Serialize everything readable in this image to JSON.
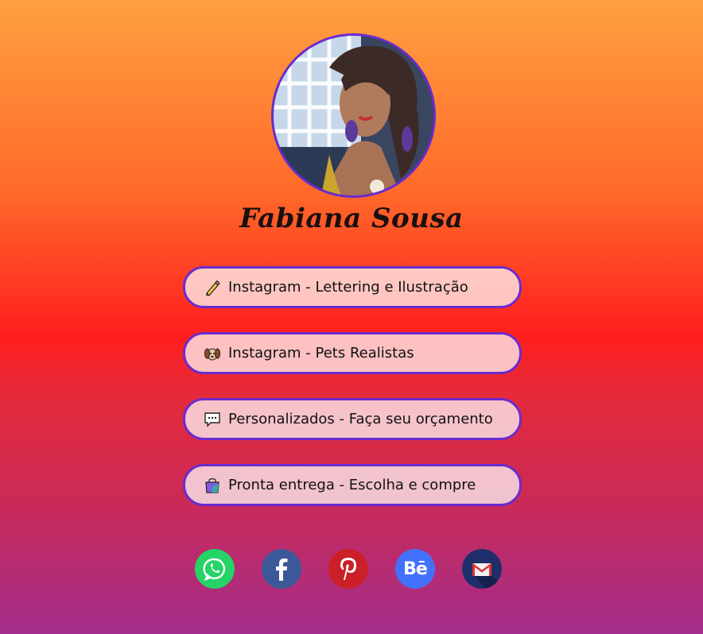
{
  "profile": {
    "name": "Fabiana Sousa",
    "avatar_icon": "profile-photo"
  },
  "links": [
    {
      "label": "Instagram - Lettering e Ilustração",
      "icon": "pencil-icon"
    },
    {
      "label": "Instagram - Pets Realistas",
      "icon": "dog-icon"
    },
    {
      "label": "Personalizados - Faça seu orçamento",
      "icon": "speech-bubble-icon"
    },
    {
      "label": "Pronta entrega - Escolha e compre",
      "icon": "shopping-bag-icon"
    }
  ],
  "social": [
    {
      "name": "whatsapp",
      "color": "#25d366"
    },
    {
      "name": "facebook",
      "color": "#3b5998"
    },
    {
      "name": "pinterest",
      "color": "#cb2027"
    },
    {
      "name": "behance",
      "color": "#4272fb",
      "text": "Bē"
    },
    {
      "name": "email",
      "color": "#1f2f6b"
    }
  ],
  "colors": {
    "border": "#6a2bd0",
    "gradient_top": "#ffa040",
    "gradient_mid": "#ff1e1e",
    "gradient_bottom": "#a32d8c"
  }
}
